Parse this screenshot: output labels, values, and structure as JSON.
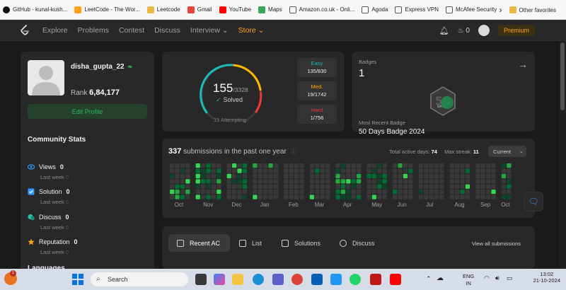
{
  "bookmarks": [
    "GitHub - kunal-kush...",
    "LeetCode - The Wor...",
    "Leetcode",
    "Gmail",
    "YouTube",
    "Maps",
    "Amazon.co.uk - Onli...",
    "Agoda",
    "Express VPN",
    "McAfee Security"
  ],
  "bookmarks_right": {
    "more": "›",
    "other": "Other favorites"
  },
  "nav": {
    "items": [
      "Explore",
      "Problems",
      "Contest",
      "Discuss",
      "Interview ⌄"
    ],
    "store": "Store ⌄",
    "coins": "0",
    "premium": "Premium"
  },
  "profile": {
    "username": "disha_gupta_22",
    "rank_label": "Rank",
    "rank_value": "6,84,177",
    "edit_button": "Edit Profile",
    "community_title": "Community Stats",
    "stats": [
      {
        "label": "Views",
        "value": "0",
        "week_label": "Last week",
        "week_value": "0"
      },
      {
        "label": "Solution",
        "value": "0",
        "week_label": "Last week",
        "week_value": "0"
      },
      {
        "label": "Discuss",
        "value": "0",
        "week_label": "Last week",
        "week_value": "0"
      },
      {
        "label": "Reputation",
        "value": "0",
        "week_label": "Last week",
        "week_value": "0"
      }
    ],
    "languages_title": "Languages"
  },
  "solved": {
    "count": "155",
    "total": "/3328",
    "label": "Solved",
    "attempting": "15 Attempting",
    "difficulty": [
      {
        "name": "Easy",
        "value": "135/830",
        "color": "#1cbaba"
      },
      {
        "name": "Med.",
        "value": "19/1742",
        "color": "#ffb700"
      },
      {
        "name": "Hard",
        "value": "1/756",
        "color": "#f63737"
      }
    ]
  },
  "badges": {
    "label": "Badges",
    "count": "1",
    "recent_label": "Most Recent Badge",
    "recent_name": "50 Days Badge 2024",
    "badge_text": "DAYS"
  },
  "submissions": {
    "count": "337",
    "text": "submissions in the past one year",
    "active_label": "Total active days:",
    "active_value": "74",
    "streak_label": "Max streak:",
    "streak_value": "11",
    "period": "Current",
    "months": [
      "Oct",
      "Nov",
      "Dec",
      "Jan",
      "Feb",
      "Mar",
      "Apr",
      "May",
      "Jun",
      "Jul",
      "Aug",
      "Sep",
      "Oct"
    ]
  },
  "recent": {
    "tabs": [
      "Recent AC",
      "List",
      "Solutions",
      "Discuss"
    ],
    "view_all": "View all submissions"
  },
  "taskbar": {
    "search": "Search",
    "lang": "ENG",
    "region": "IN",
    "time": "13:02",
    "date": "21-10-2024",
    "notif": "1"
  },
  "colors": {
    "accent": "#ffa116",
    "green": "#2cbb5d",
    "bg": "#1a1a1a",
    "card": "#282828"
  }
}
